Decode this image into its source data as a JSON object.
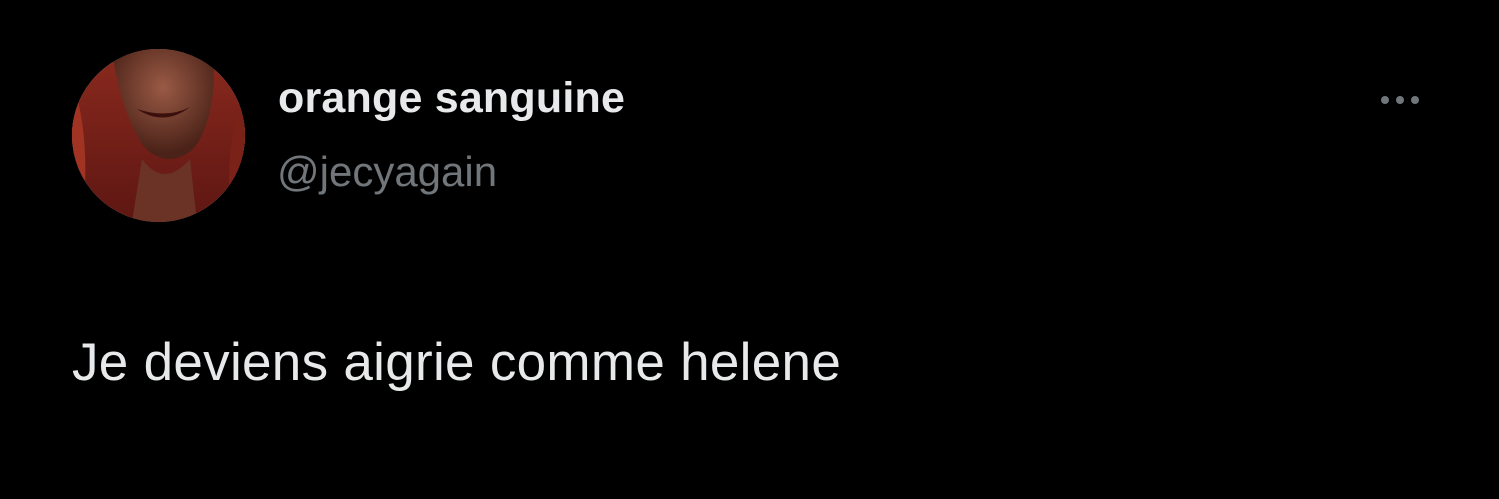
{
  "tweet": {
    "author": {
      "display_name": "orange sanguine",
      "handle": "@jecyagain",
      "avatar_icon": "profile-photo"
    },
    "more_icon": "more-options-icon",
    "text": "Je deviens aigrie comme helene"
  },
  "colors": {
    "background": "#000000",
    "primary_text": "#e7e9ea",
    "secondary_text": "#71767b"
  }
}
